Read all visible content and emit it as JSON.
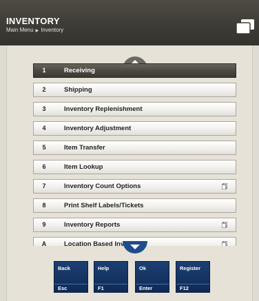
{
  "header": {
    "title": "INVENTORY",
    "breadcrumb": [
      "Main Menu",
      "Inventory"
    ],
    "window_icon": "windows-icon"
  },
  "menu": {
    "items": [
      {
        "key": "1",
        "label": "Receiving",
        "active": true,
        "icon": null
      },
      {
        "key": "2",
        "label": "Shipping",
        "active": false,
        "icon": null
      },
      {
        "key": "3",
        "label": "Inventory Replenishment",
        "active": false,
        "icon": null
      },
      {
        "key": "4",
        "label": "Inventory Adjustment",
        "active": false,
        "icon": null
      },
      {
        "key": "5",
        "label": "Item Transfer",
        "active": false,
        "icon": null
      },
      {
        "key": "6",
        "label": "Item Lookup",
        "active": false,
        "icon": null
      },
      {
        "key": "7",
        "label": "Inventory Count Options",
        "active": false,
        "icon": "submenu-doc-icon"
      },
      {
        "key": "8",
        "label": "Print Shelf Labels/Tickets",
        "active": false,
        "icon": null
      },
      {
        "key": "9",
        "label": "Inventory Reports",
        "active": false,
        "icon": "submenu-doc-icon"
      },
      {
        "key": "A",
        "label": "Location Based Inventory",
        "active": false,
        "icon": "submenu-doc-icon"
      }
    ]
  },
  "function_keys": [
    {
      "label": "Back",
      "key": "Esc"
    },
    {
      "label": "Help",
      "key": "F1"
    },
    {
      "label": "Ok",
      "key": "Enter"
    },
    {
      "label": "Register",
      "key": "F12"
    }
  ],
  "colors": {
    "header": "#3d3b35",
    "active_item": "#4a473f",
    "function_key": "#0f2a55",
    "background": "#dedbd3"
  }
}
